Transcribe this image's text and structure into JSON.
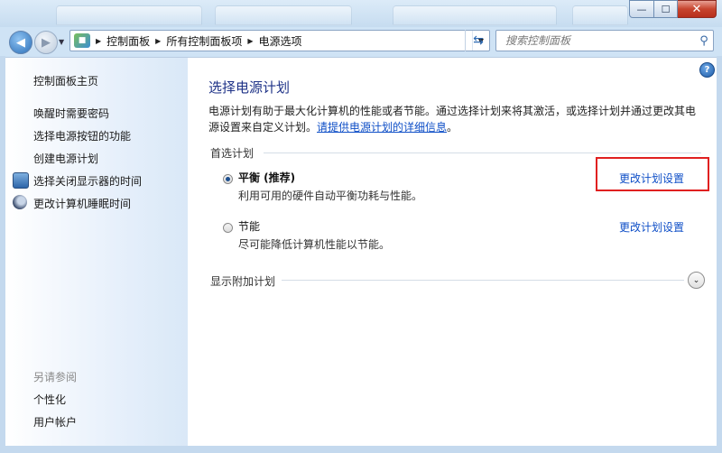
{
  "window": {
    "close_glyph": "✕",
    "maximize_glyph": "☐",
    "minimize_glyph": "—"
  },
  "nav": {
    "breadcrumbs": [
      "控制面板",
      "所有控制面板项",
      "电源选项"
    ],
    "search_placeholder": "搜索控制面板"
  },
  "sidebar": {
    "home": "控制面板主页",
    "links": [
      {
        "label": "唤醒时需要密码",
        "icon": null
      },
      {
        "label": "选择电源按钮的功能",
        "icon": null
      },
      {
        "label": "创建电源计划",
        "icon": null
      },
      {
        "label": "选择关闭显示器的时间",
        "icon": "monitor-icon"
      },
      {
        "label": "更改计算机睡眠时间",
        "icon": "moon-icon"
      }
    ],
    "see_also_title": "另请参阅",
    "see_also": [
      "个性化",
      "用户帐户"
    ]
  },
  "main": {
    "heading": "选择电源计划",
    "description": "电源计划有助于最大化计算机的性能或者节能。通过选择计划来将其激活，或选择计划并通过更改其电源设置来自定义计划。",
    "info_link": "请提供电源计划的详细信息",
    "description_tail": "。",
    "preferred_group": "首选计划",
    "plans": [
      {
        "name": "平衡 (推荐)",
        "desc": "利用可用的硬件自动平衡功耗与性能。",
        "link": "更改计划设置",
        "selected": true
      },
      {
        "name": "节能",
        "desc": "尽可能降低计算机性能以节能。",
        "link": "更改计划设置",
        "selected": false
      }
    ],
    "additional_group": "显示附加计划",
    "help_glyph": "?",
    "expand_glyph": "⌄",
    "highlight_color": "#e02020"
  }
}
